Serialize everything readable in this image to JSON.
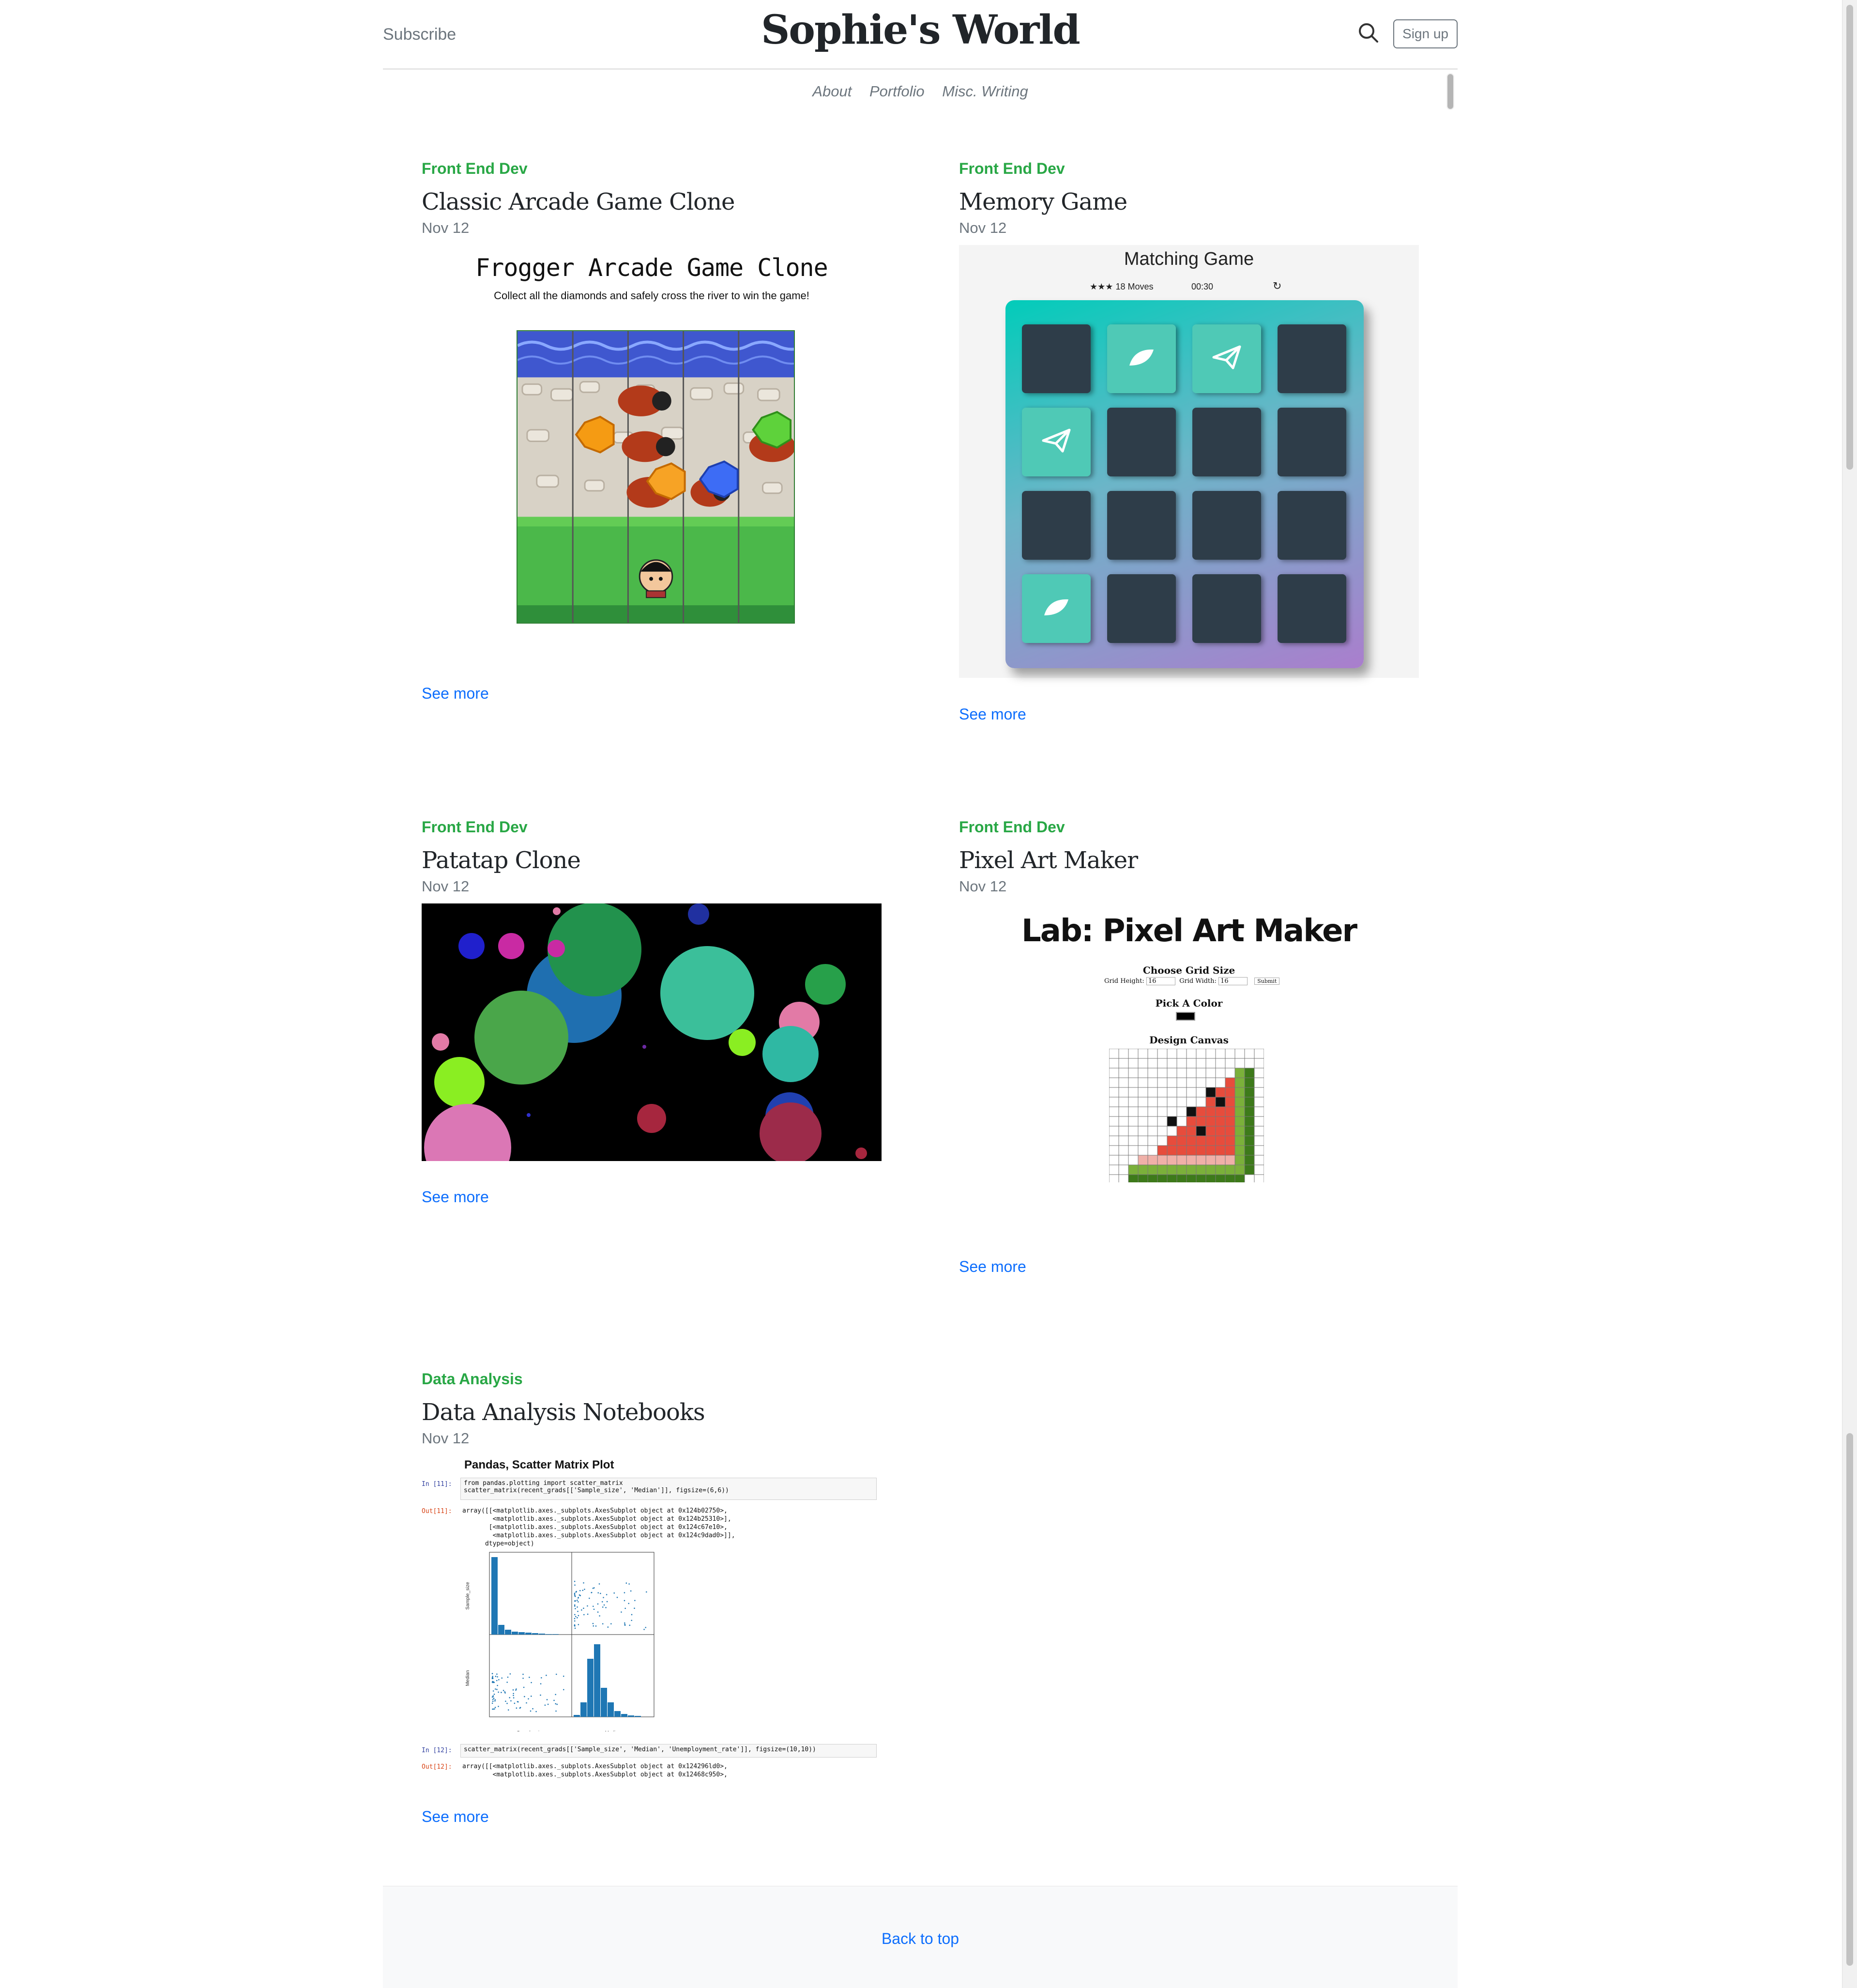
{
  "header": {
    "subscribe_label": "Subscribe",
    "site_title": "Sophie's World",
    "signup_label": "Sign up"
  },
  "nav": {
    "items": [
      "About",
      "Portfolio",
      "Misc. Writing"
    ]
  },
  "posts": [
    {
      "category": "Front End Dev",
      "title": "Classic Arcade Game Clone",
      "date": "Nov 12",
      "see_more": "See more",
      "thumb": {
        "title": "Frogger Arcade Game Clone",
        "subtitle": "Collect all the diamonds and safely cross the river to win the game!"
      }
    },
    {
      "category": "Front End Dev",
      "title": "Memory Game",
      "date": "Nov 12",
      "see_more": "See more",
      "thumb": {
        "title": "Matching Game",
        "moves": "18 Moves",
        "timer": "00:30"
      }
    },
    {
      "category": "Front End Dev",
      "title": "Patatap Clone",
      "date": "Nov 12",
      "see_more": "See more"
    },
    {
      "category": "Front End Dev",
      "title": "Pixel Art Maker",
      "date": "Nov 12",
      "see_more": "See more",
      "thumb": {
        "title": "Lab: Pixel Art Maker",
        "grid_size_label": "Choose Grid Size",
        "grid_height_label": "Grid Height:",
        "grid_height_value": "16",
        "grid_width_label": "Grid Width:",
        "grid_width_value": "16",
        "submit_label": "Submit",
        "color_label": "Pick A Color",
        "canvas_label": "Design Canvas"
      }
    },
    {
      "category": "Data Analysis",
      "title": "Data Analysis Notebooks",
      "date": "Nov 12",
      "see_more": "See more",
      "thumb": {
        "title": "Pandas, Scatter Matrix Plot",
        "in11": "In [11]:",
        "code11a": "from pandas.plotting import scatter_matrix",
        "code11b": "scatter_matrix(recent_grads[['Sample_size', 'Median']], figsize=(6,6))",
        "out11": "Out[11]:",
        "out11_text": "array([[<matplotlib.axes._subplots.AxesSubplot object at 0x124b02750>,\n        <matplotlib.axes._subplots.AxesSubplot object at 0x124b25310>],\n       [<matplotlib.axes._subplots.AxesSubplot object at 0x124c67e10>,\n        <matplotlib.axes._subplots.AxesSubplot object at 0x124c9dad0>]],\n      dtype=object)",
        "in12": "In [12]:",
        "code12": "scatter_matrix(recent_grads[['Sample_size', 'Median', 'Unemployment_rate']], figsize=(10,10))",
        "out12": "Out[12]:",
        "out12_text": "array([[<matplotlib.axes._subplots.AxesSubplot object at 0x124296ld0>,\n        <matplotlib.axes._subplots.AxesSubplot object at 0x12468c950>,",
        "ylabel_top": "Sample_size",
        "ylabel_bottom": "Median",
        "xlabel_left": "Sample_size",
        "xlabel_right": "Median"
      }
    }
  ],
  "footer": {
    "back_to_top": "Back to top"
  },
  "colors": {
    "category": "#28a745",
    "link": "#0d6efd",
    "muted": "#6c757d"
  }
}
